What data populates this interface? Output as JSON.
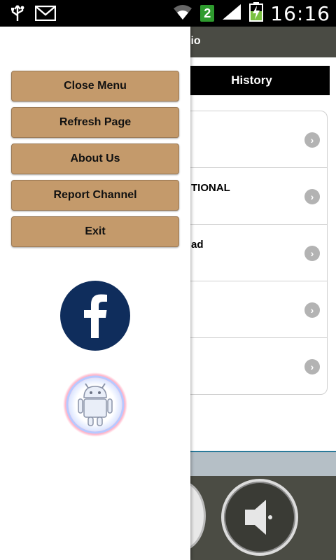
{
  "status_bar": {
    "time": "16:16",
    "sim_slot": "2",
    "icons": [
      "usb-icon",
      "email-icon",
      "wifi-icon",
      "signal-icon",
      "battery-charging-icon"
    ]
  },
  "app": {
    "header_title_fragment": "lio",
    "tab_label": "History",
    "rows": [
      {
        "label": ""
      },
      {
        "label": "TIONAL"
      },
      {
        "label": "ad"
      },
      {
        "label": ""
      },
      {
        "label": ""
      }
    ]
  },
  "drawer": {
    "menu": [
      {
        "id": "close-menu",
        "label": "Close Menu"
      },
      {
        "id": "refresh-page",
        "label": "Refresh Page"
      },
      {
        "id": "about-us",
        "label": "About Us"
      },
      {
        "id": "report-channel",
        "label": "Report Channel"
      },
      {
        "id": "exit",
        "label": "Exit"
      }
    ],
    "facebook_icon": "facebook-icon",
    "android_icon": "android-icon"
  },
  "colors": {
    "menu_button": "#c49a6b",
    "facebook": "#0f2d5c",
    "header": "#4a4b44"
  }
}
